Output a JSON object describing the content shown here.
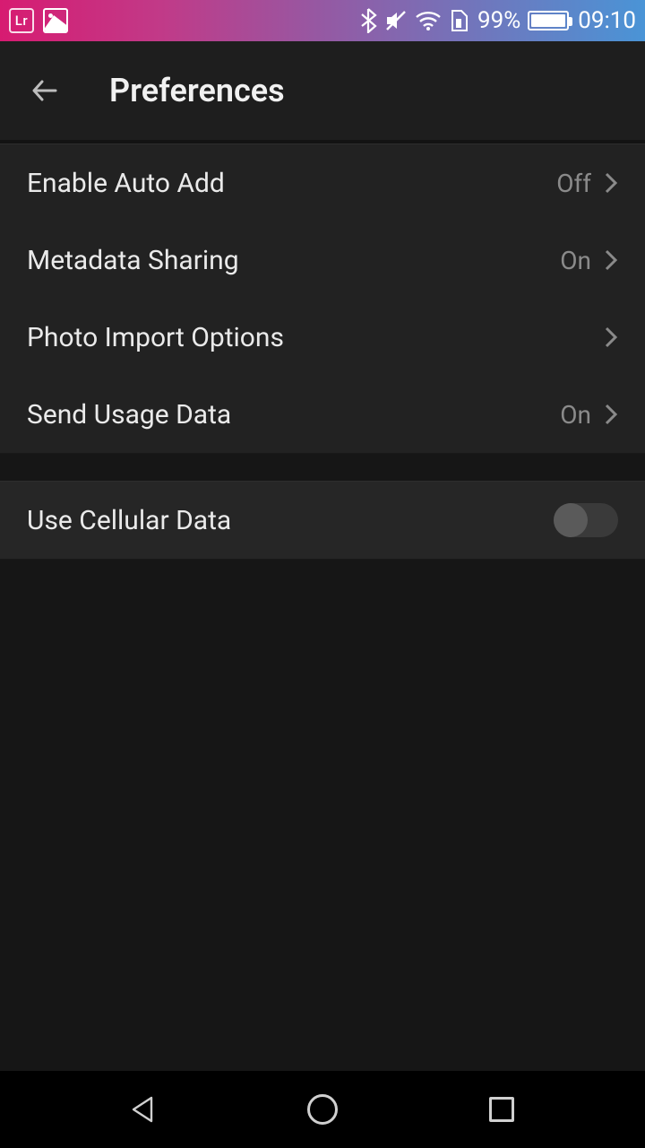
{
  "statusbar": {
    "app_badge": "Lr",
    "battery_pct_text": "99%",
    "battery_fill_pct": 99,
    "time": "09:10"
  },
  "header": {
    "title": "Preferences"
  },
  "settings": {
    "auto_add": {
      "label": "Enable Auto Add",
      "value": "Off"
    },
    "metadata": {
      "label": "Metadata Sharing",
      "value": "On"
    },
    "import": {
      "label": "Photo Import Options",
      "value": ""
    },
    "usage": {
      "label": "Send Usage Data",
      "value": "On"
    },
    "cellular": {
      "label": "Use Cellular Data",
      "toggle": "off"
    }
  }
}
